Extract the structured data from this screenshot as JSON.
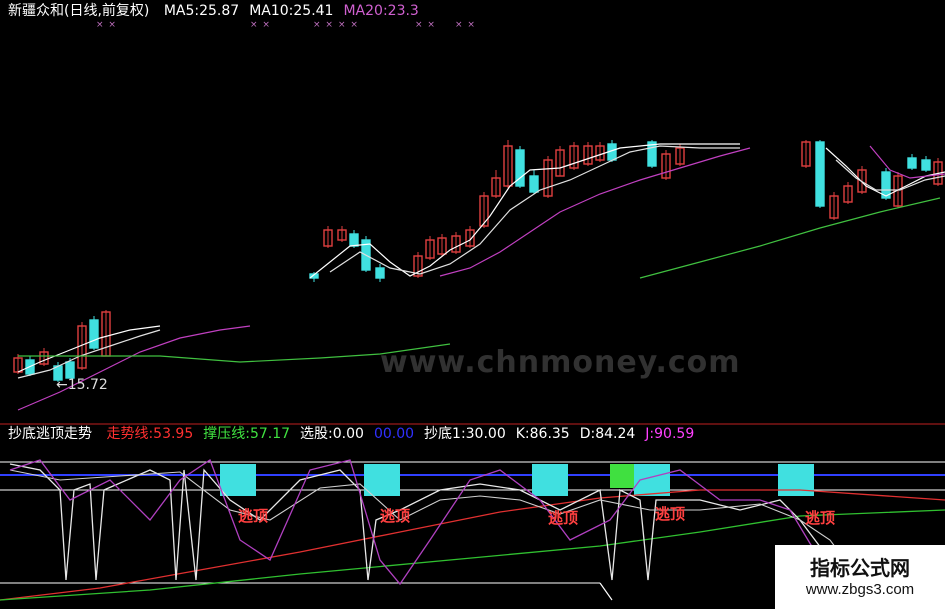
{
  "chart_data": [
    {
      "type": "candlestick",
      "title": "新疆众和(日线,前复权)",
      "legend": [
        {
          "name": "MA5",
          "value": "25.87",
          "color": "#ffffff"
        },
        {
          "name": "MA10",
          "value": "25.41",
          "color": "#ffffff"
        },
        {
          "name": "MA20",
          "value": "23.3",
          "color": "#d060d0"
        }
      ],
      "annotations": [
        "←15.72"
      ],
      "marker_glyph": "× ×"
    },
    {
      "type": "line",
      "title": "抄底逃顶走势",
      "legend": [
        {
          "name": "走势线",
          "value": "53.95",
          "color": "#ff3030"
        },
        {
          "name": "撑压线",
          "value": "57.17",
          "color": "#40e040"
        },
        {
          "name": "选股",
          "value": "0.00",
          "color": "#ffffff"
        },
        {
          "name": "",
          "value": "00.00",
          "color": "#3030ff"
        },
        {
          "name": "抄底1",
          "value": "30.00",
          "color": "#ffffff"
        },
        {
          "name": "K",
          "value": "86.35",
          "color": "#ffffff"
        },
        {
          "name": "D",
          "value": "84.24",
          "color": "#ffffff"
        },
        {
          "name": "J",
          "value": "90.59",
          "color": "#ff40ff"
        }
      ],
      "signal_label": "逃顶"
    }
  ],
  "watermark": "www.chnmoney.com",
  "brand": {
    "title": "指标公式网",
    "url": "www.zbgs3.com"
  },
  "colors": {
    "up": "#e04040",
    "down": "#40e0e0",
    "ma5": "#ffffff",
    "ma10": "#e0e0e0",
    "ma20": "#c040c0",
    "ma60": "#40c040",
    "axis": "#c02020"
  }
}
